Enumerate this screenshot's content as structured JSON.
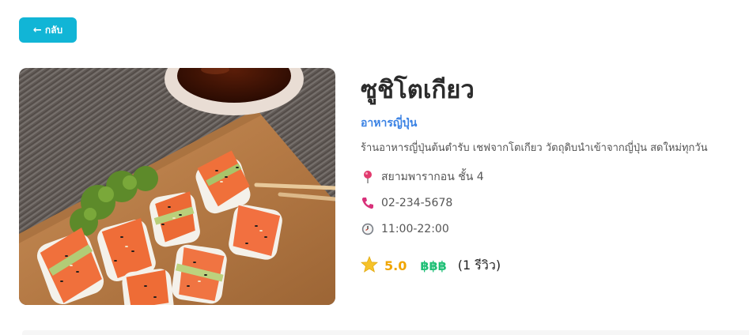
{
  "back_button": {
    "arrow": "←",
    "label": "กลับ"
  },
  "restaurant": {
    "image_alt": "sushi-photo",
    "name": "ซูชิโตเกียว",
    "category": "อาหารญี่ปุ่น",
    "description": "ร้านอาหารญี่ปุ่นต้นตำรับ เชฟจากโตเกียว วัตถุดิบนำเข้าจากญี่ปุ่น สดใหม่ทุกวัน",
    "location": "สยามพารากอน ชั้น 4",
    "phone": "02-234-5678",
    "hours": "11:00-22:00",
    "rating": "5.0",
    "price_level": "฿฿฿",
    "review_count": "(1 รีวิว)"
  },
  "icons": {
    "location": "pin-icon",
    "phone": "phone-icon",
    "hours": "clock-icon",
    "rating": "star-icon"
  },
  "colors": {
    "back_button": "#11b5d6",
    "category": "#3a82e4",
    "rating": "#f0a500",
    "price": "#1fbf76"
  }
}
